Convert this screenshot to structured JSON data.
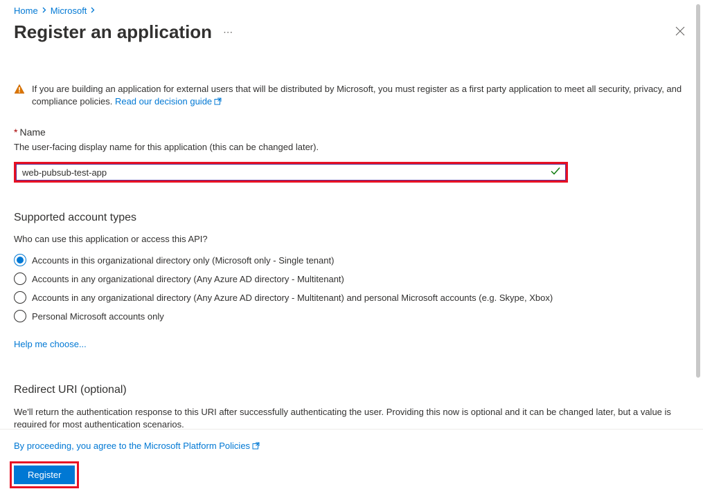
{
  "breadcrumb": {
    "home": "Home",
    "microsoft": "Microsoft"
  },
  "header": {
    "title": "Register an application"
  },
  "warning": {
    "text_before": "If you are building an application for external users that will be distributed by Microsoft, you must register as a first party application to meet all security, privacy, and compliance policies. ",
    "link": "Read our decision guide"
  },
  "name_field": {
    "label": "Name",
    "hint": "The user-facing display name for this application (this can be changed later).",
    "value": "web-pubsub-test-app"
  },
  "account_types": {
    "title": "Supported account types",
    "question": "Who can use this application or access this API?",
    "options": [
      "Accounts in this organizational directory only (Microsoft only - Single tenant)",
      "Accounts in any organizational directory (Any Azure AD directory - Multitenant)",
      "Accounts in any organizational directory (Any Azure AD directory - Multitenant) and personal Microsoft accounts (e.g. Skype, Xbox)",
      "Personal Microsoft accounts only"
    ],
    "help_link": "Help me choose..."
  },
  "redirect": {
    "title": "Redirect URI (optional)",
    "desc": "We'll return the authentication response to this URI after successfully authenticating the user. Providing this now is optional and it can be changed later, but a value is required for most authentication scenarios."
  },
  "footer": {
    "policy_text": "By proceeding, you agree to the Microsoft Platform Policies",
    "register": "Register"
  }
}
